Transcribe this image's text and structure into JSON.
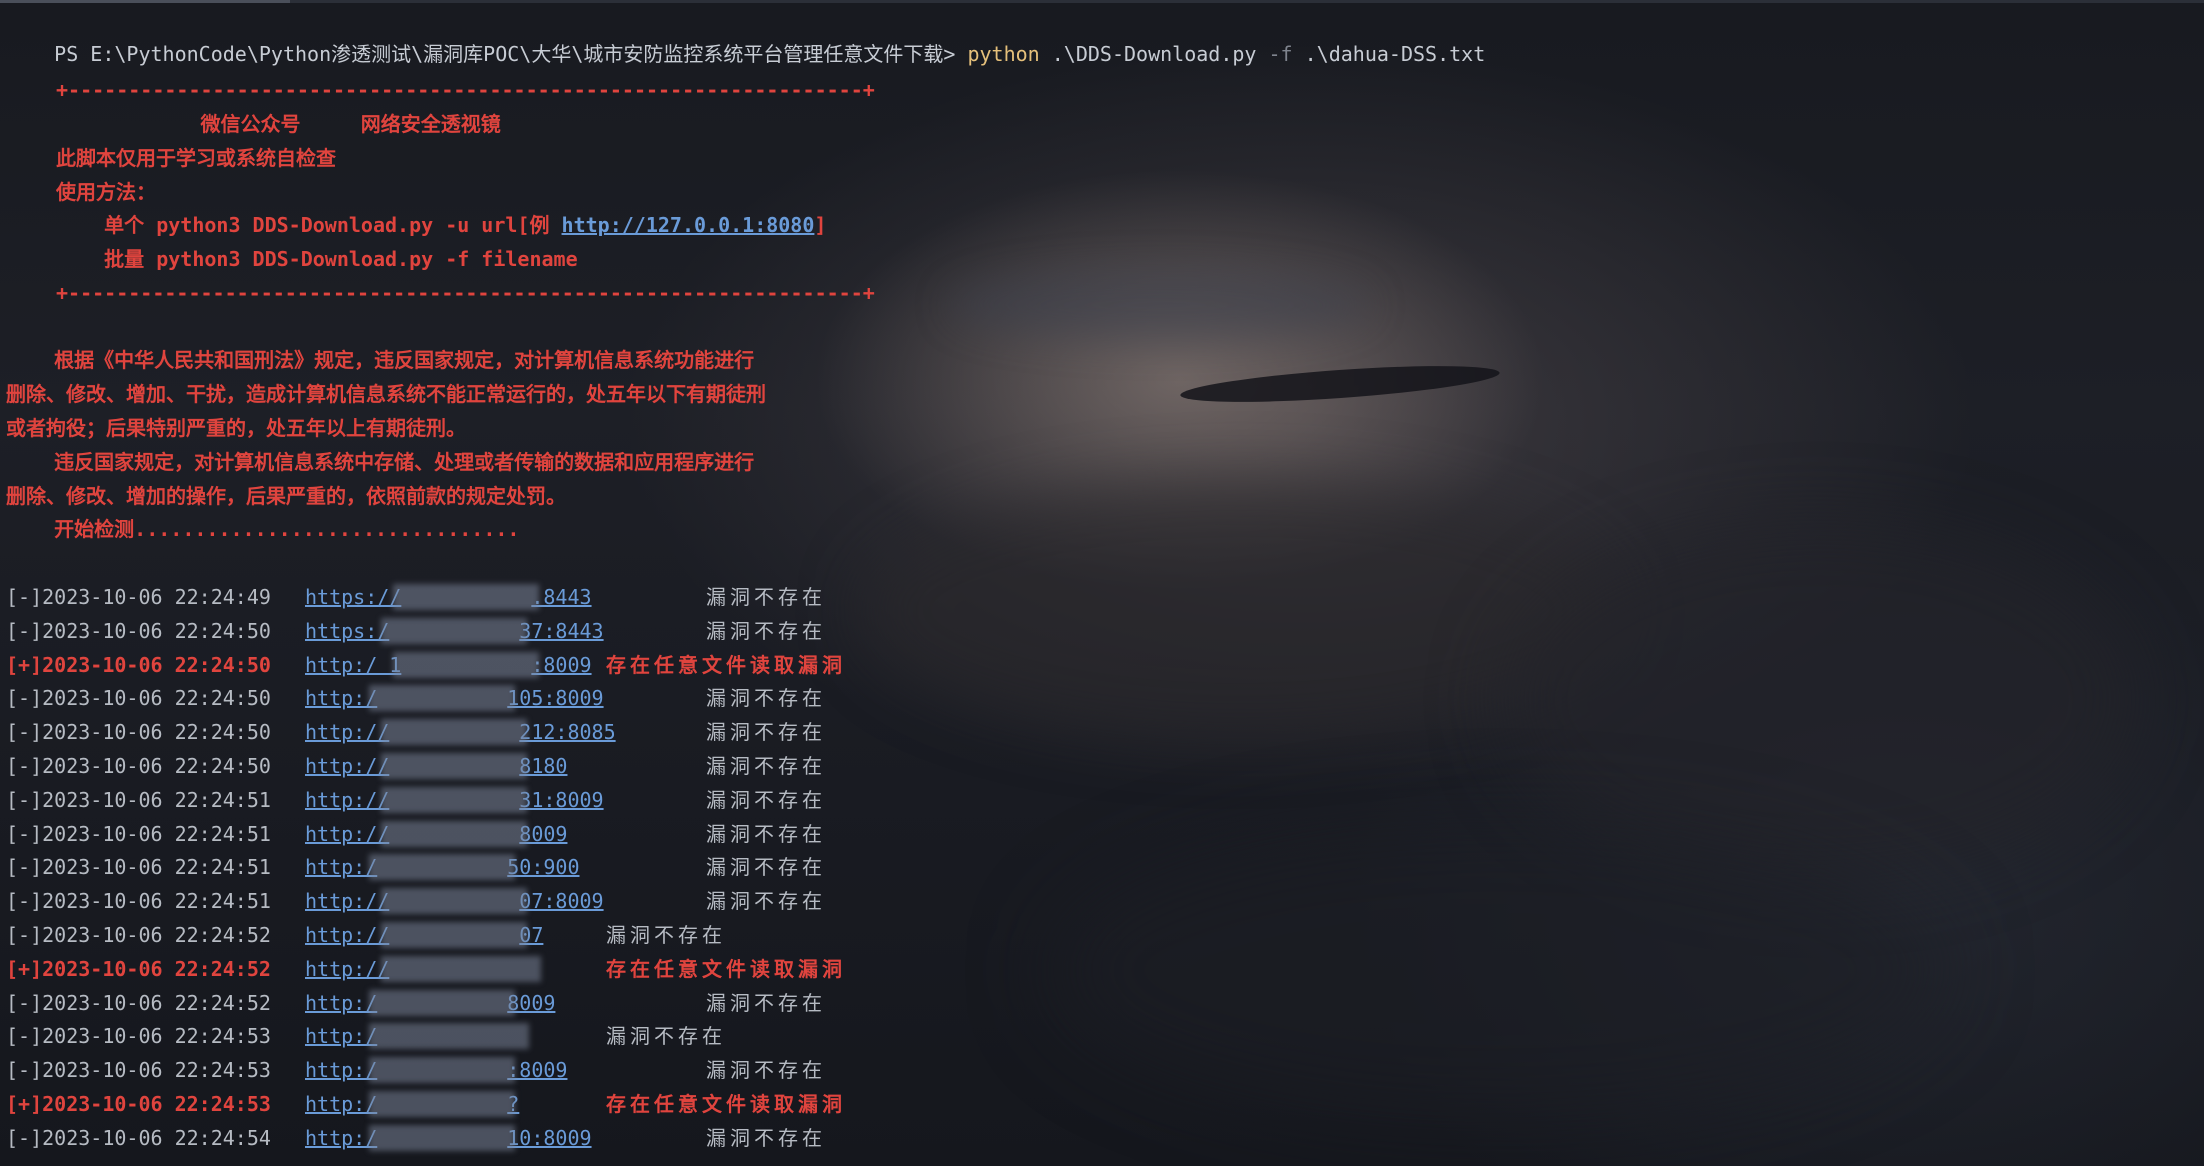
{
  "prompt": {
    "ps": "PS E:\\PythonCode\\Python渗透测试\\漏洞库POC\\大华\\城市安防监控系统平台管理任意文件下载> ",
    "cmd": "python",
    "arg1": " .\\DDS-Download.py ",
    "flag": "-f",
    "arg2": " .\\dahua-DSS.txt"
  },
  "banner": {
    "border": "+------------------------------------------------------------------+",
    "title": "            微信公众号     网络安全透视镜",
    "line1": "此脚本仅用于学习或系统自检查",
    "line2": "使用方法：",
    "usage1_prefix": "    单个 python3 DDS-Download.py -u url[例 ",
    "usage1_link": "http://127.0.0.1:8080",
    "usage1_suffix": "]",
    "usage2": "    批量 python3 DDS-Download.py -f filename"
  },
  "legal": {
    "p1": "    根据《中华人民共和国刑法》规定，违反国家规定，对计算机信息系统功能进行",
    "p2": "删除、修改、增加、干扰，造成计算机信息系统不能正常运行的，处五年以下有期徒刑",
    "p3": "或者拘役；后果特别严重的，处五年以上有期徒刑。",
    "p4": "    违反国家规定，对计算机信息系统中存储、处理或者传输的数据和应用程序进行",
    "p5": "删除、修改、增加的操作，后果严重的，依照前款的规定处罚。",
    "start": "    开始检测................................"
  },
  "results": [
    {
      "tag": "[-]",
      "time": "2023-10-06 22:24:49",
      "url": "https://",
      "tail": ".8443",
      "status": "漏洞不存在",
      "hit": false
    },
    {
      "tag": "[-]",
      "time": "2023-10-06 22:24:50",
      "url": "https:/",
      "tail": "37:8443",
      "status": "漏洞不存在",
      "hit": false
    },
    {
      "tag": "[+]",
      "time": "2023-10-06 22:24:50",
      "url": "http:/ 1",
      "tail": ":8009",
      "status": "存在任意文件读取漏洞",
      "hit": true
    },
    {
      "tag": "[-]",
      "time": "2023-10-06 22:24:50",
      "url": "http:/",
      "tail": "105:8009",
      "status": "漏洞不存在",
      "hit": false
    },
    {
      "tag": "[-]",
      "time": "2023-10-06 22:24:50",
      "url": "http://",
      "tail": "212:8085",
      "status": "漏洞不存在",
      "hit": false
    },
    {
      "tag": "[-]",
      "time": "2023-10-06 22:24:50",
      "url": "http://",
      "tail": "8180",
      "status": "漏洞不存在",
      "hit": false
    },
    {
      "tag": "[-]",
      "time": "2023-10-06 22:24:51",
      "url": "http://",
      "tail": "31:8009",
      "status": "漏洞不存在",
      "hit": false
    },
    {
      "tag": "[-]",
      "time": "2023-10-06 22:24:51",
      "url": "http://",
      "tail": "8009",
      "status": "漏洞不存在",
      "hit": false
    },
    {
      "tag": "[-]",
      "time": "2023-10-06 22:24:51",
      "url": "http:/",
      "tail": "50:900",
      "status": "漏洞不存在",
      "hit": false
    },
    {
      "tag": "[-]",
      "time": "2023-10-06 22:24:51",
      "url": "http://",
      "tail": "07:8009",
      "status": "漏洞不存在",
      "hit": false
    },
    {
      "tag": "[-]",
      "time": "2023-10-06 22:24:52",
      "url": "http://",
      "tail": "07",
      "status": "漏洞不存在",
      "hit": false
    },
    {
      "tag": "[+]",
      "time": "2023-10-06 22:24:52",
      "url": "http://",
      "tail": "",
      "status": "存在任意文件读取漏洞",
      "hit": true
    },
    {
      "tag": "[-]",
      "time": "2023-10-06 22:24:52",
      "url": "http:/",
      "tail": "8009",
      "status": "漏洞不存在",
      "hit": false
    },
    {
      "tag": "[-]",
      "time": "2023-10-06 22:24:53",
      "url": "http:/",
      "tail": "",
      "status": "漏洞不存在",
      "hit": false
    },
    {
      "tag": "[-]",
      "time": "2023-10-06 22:24:53",
      "url": "http:/",
      "tail": ":8009",
      "status": "漏洞不存在",
      "hit": false
    },
    {
      "tag": "[+]",
      "time": "2023-10-06 22:24:53",
      "url": "http:/",
      "tail": "?",
      "status": "存在任意文件读取漏洞",
      "hit": true
    },
    {
      "tag": "[-]",
      "time": "2023-10-06 22:24:54",
      "url": "http:/",
      "tail": "10:8009",
      "status": "漏洞不存在",
      "hit": false
    }
  ]
}
